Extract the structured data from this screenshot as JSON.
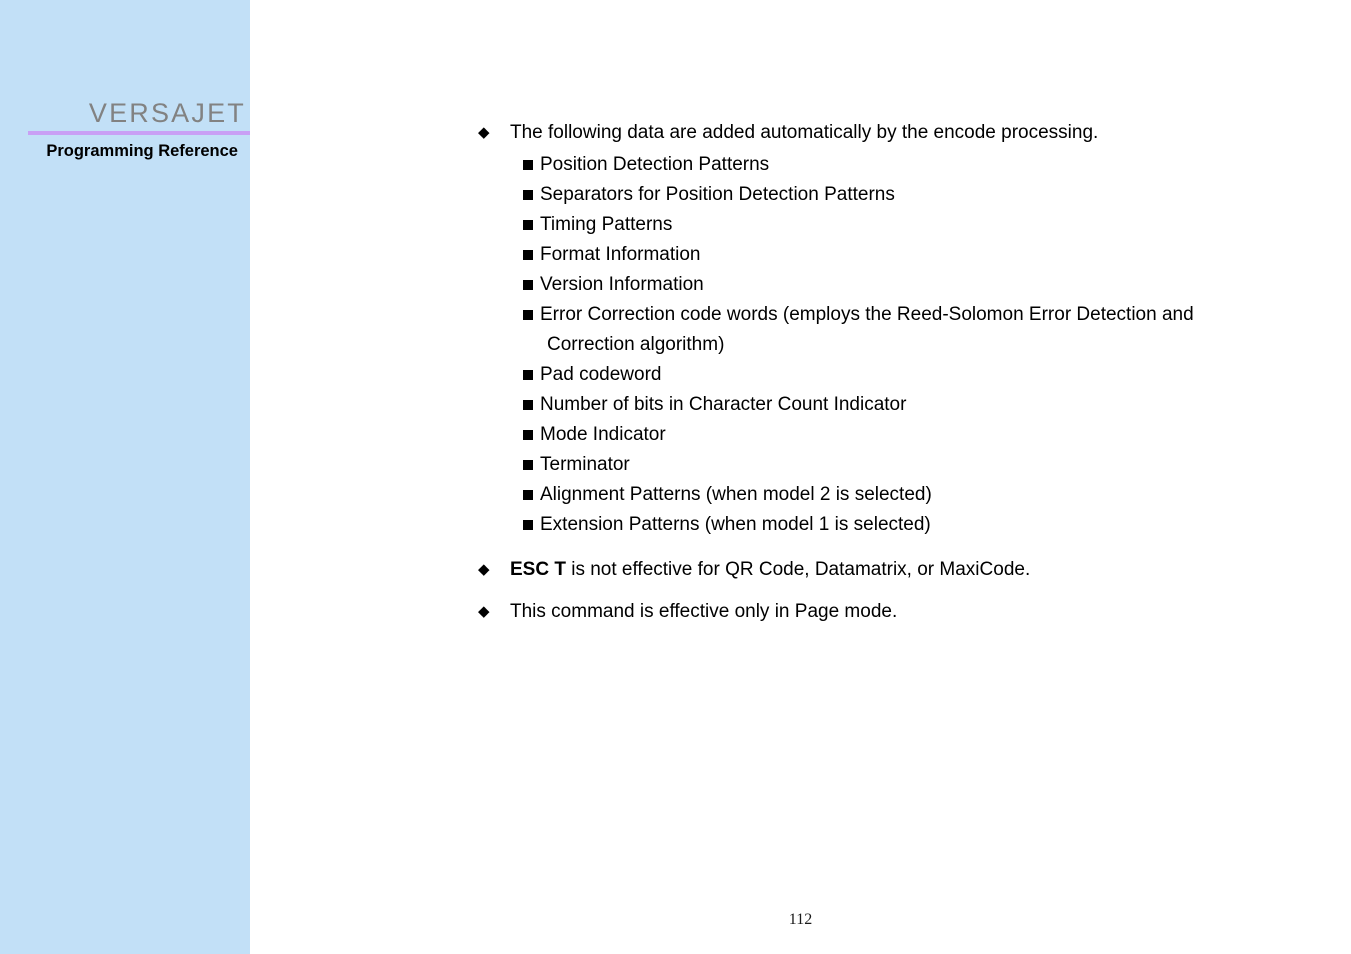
{
  "sidebar": {
    "brand_title": "VERSAJET",
    "brand_subtitle": "Programming Reference",
    "brand_title_color": "#828282",
    "rule_color": "#c9a0f5",
    "background_color": "#c2e0f7"
  },
  "content": {
    "notes": [
      {
        "marker": "diamond-bullet-icon",
        "marker_glyph": "◆",
        "text": "The following data are added automatically by the encode processing."
      },
      {
        "marker": "diamond-bullet-icon",
        "marker_glyph": "◆",
        "bold_prefix": "ESC T",
        "text": " is not effective for QR Code, Datamatrix, or MaxiCode."
      },
      {
        "marker": "diamond-bullet-icon",
        "marker_glyph": "◆",
        "text": "This command is effective only in Page mode."
      }
    ],
    "sub_items": [
      {
        "text": "Position Detection Patterns"
      },
      {
        "text": "Separators for Position Detection Patterns"
      },
      {
        "text": "Timing Patterns"
      },
      {
        "text": "Format Information"
      },
      {
        "text": "Version Information"
      },
      {
        "text": "Error Correction code words (employs the Reed-Solomon Error Detection and",
        "continuation": "Correction algorithm)"
      },
      {
        "text": "Pad codeword"
      },
      {
        "text": "Number of bits in Character Count Indicator"
      },
      {
        "text": "Mode Indicator"
      },
      {
        "text": "Terminator"
      },
      {
        "text": "Alignment Patterns (when model 2 is selected)"
      },
      {
        "text": "Extension Patterns (when model 1 is selected)"
      }
    ]
  },
  "footer": {
    "page_number": "112"
  }
}
